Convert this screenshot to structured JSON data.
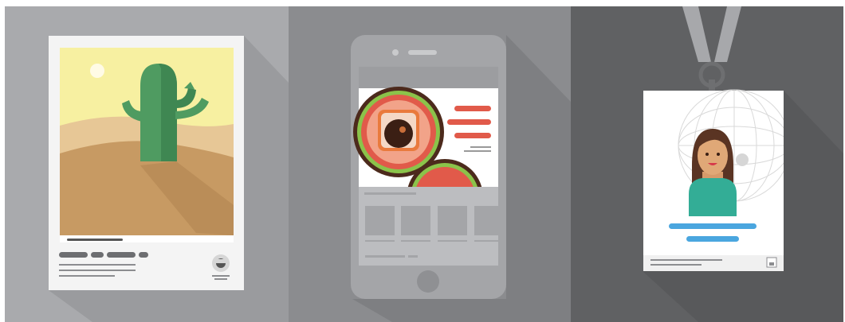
{
  "colors": {
    "panel_left": "#a9aaad",
    "panel_middle": "#8b8c8f",
    "panel_right": "#606163",
    "card_white": "#f6f6f6",
    "cactus_green": "#4f9b61",
    "sand": "#c8a06a",
    "sky": "#f7f0a1",
    "tomato_red": "#e15a4a",
    "accent_blue": "#4aa6df",
    "shirt_teal": "#33ad96",
    "hair_brown": "#5a3423",
    "lanyard_gray": "#a7a8ab"
  },
  "icons": [
    "photo-print-icon",
    "smartphone-icon",
    "id-badge-icon",
    "cactus-icon",
    "sun-icon",
    "sushi-roll-icon",
    "person-avatar-icon",
    "lanyard-icon"
  ]
}
